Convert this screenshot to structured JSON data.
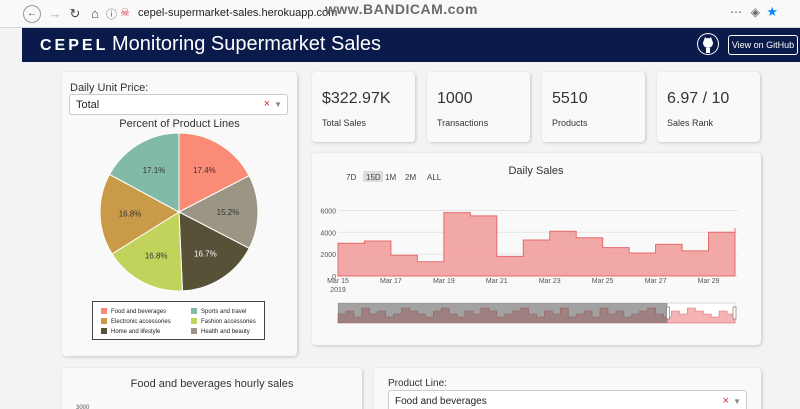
{
  "browser": {
    "url": "cepel-supermarket-sales.herokuapp.com",
    "watermark": "www.BANDICAM.com"
  },
  "header": {
    "logo": "CEPEL",
    "title": "Monitoring Supermarket Sales",
    "github_button": "View on GitHub"
  },
  "filter": {
    "label": "Daily Unit Price:",
    "value": "Total"
  },
  "kpis": [
    {
      "value": "$322.97K",
      "label": "Total Sales"
    },
    {
      "value": "1000",
      "label": "Transactions"
    },
    {
      "value": "5510",
      "label": "Products"
    },
    {
      "value": "6.97 / 10",
      "label": "Sales Rank"
    }
  ],
  "pie": {
    "title": "Percent of Product Lines",
    "slices": [
      {
        "label": "Food and beverages",
        "value": 17.4,
        "text": "17.4%",
        "color": "#f98b77"
      },
      {
        "label": "Health and beauty",
        "value": 15.2,
        "text": "15.2%",
        "color": "#9b9585"
      },
      {
        "label": "Home and lifestyle",
        "value": 16.7,
        "text": "16.7%",
        "color": "#575138"
      },
      {
        "label": "Fashion accessories",
        "value": 16.8,
        "text": "16.8%",
        "color": "#c2d35c"
      },
      {
        "label": "Electronic accessories",
        "value": 16.8,
        "text": "16.8%",
        "color": "#c99a47"
      },
      {
        "label": "Sports and travel",
        "value": 17.1,
        "text": "17.1%",
        "color": "#81bba8"
      }
    ],
    "legend": [
      "Food and beverages",
      "Sports and travel",
      "Electronic accessories",
      "Fashion accessories",
      "Home and lifestyle",
      "Health and beauty"
    ]
  },
  "daily": {
    "range_buttons": [
      "7D",
      "15D",
      "1M",
      "2M",
      "ALL"
    ]
  },
  "chart_data": [
    {
      "type": "pie",
      "title": "Percent of Product Lines",
      "categories": [
        "Food and beverages",
        "Health and beauty",
        "Home and lifestyle",
        "Fashion accessories",
        "Electronic accessories",
        "Sports and travel"
      ],
      "values": [
        17.4,
        15.2,
        16.7,
        16.8,
        16.8,
        17.1
      ],
      "legend": "bottom"
    },
    {
      "type": "area",
      "title": "Daily Sales",
      "x": [
        "Mar 15",
        "Mar 16",
        "Mar 17",
        "Mar 18",
        "Mar 19",
        "Mar 20",
        "Mar 21",
        "Mar 22",
        "Mar 23",
        "Mar 24",
        "Mar 25",
        "Mar 26",
        "Mar 27",
        "Mar 28",
        "Mar 29",
        "Mar 30"
      ],
      "values": [
        3000,
        3200,
        1900,
        1300,
        5800,
        5500,
        1800,
        3300,
        4100,
        3500,
        2600,
        2100,
        2900,
        2300,
        4000,
        4400
      ],
      "x_ticks": [
        "Mar 15",
        "Mar 17",
        "Mar 19",
        "Mar 21",
        "Mar 23",
        "Mar 25",
        "Mar 27",
        "Mar 29"
      ],
      "x_tick_year": "2019",
      "y_ticks": [
        0,
        2000,
        4000,
        6000
      ],
      "ylim": [
        0,
        6500
      ],
      "color": "#f29a9a"
    }
  ],
  "hourly": {
    "title": "Food and beverages hourly sales",
    "tick": "3000"
  },
  "product_line": {
    "label": "Product Line:",
    "value": "Food and beverages"
  }
}
